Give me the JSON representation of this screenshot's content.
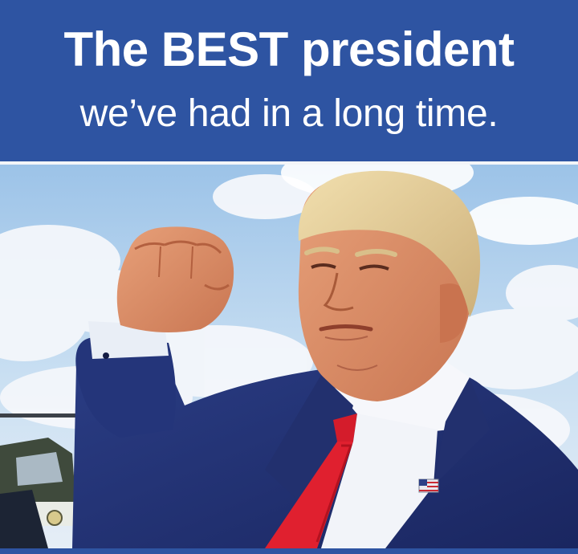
{
  "banner": {
    "headline": "The BEST president",
    "subline": "we’ve had in a long time.",
    "color": "#2e54a2"
  },
  "photo": {
    "subject": "man in navy suit and red tie raising a clenched fist, blue sky with clouds and a helicopter in the background"
  }
}
